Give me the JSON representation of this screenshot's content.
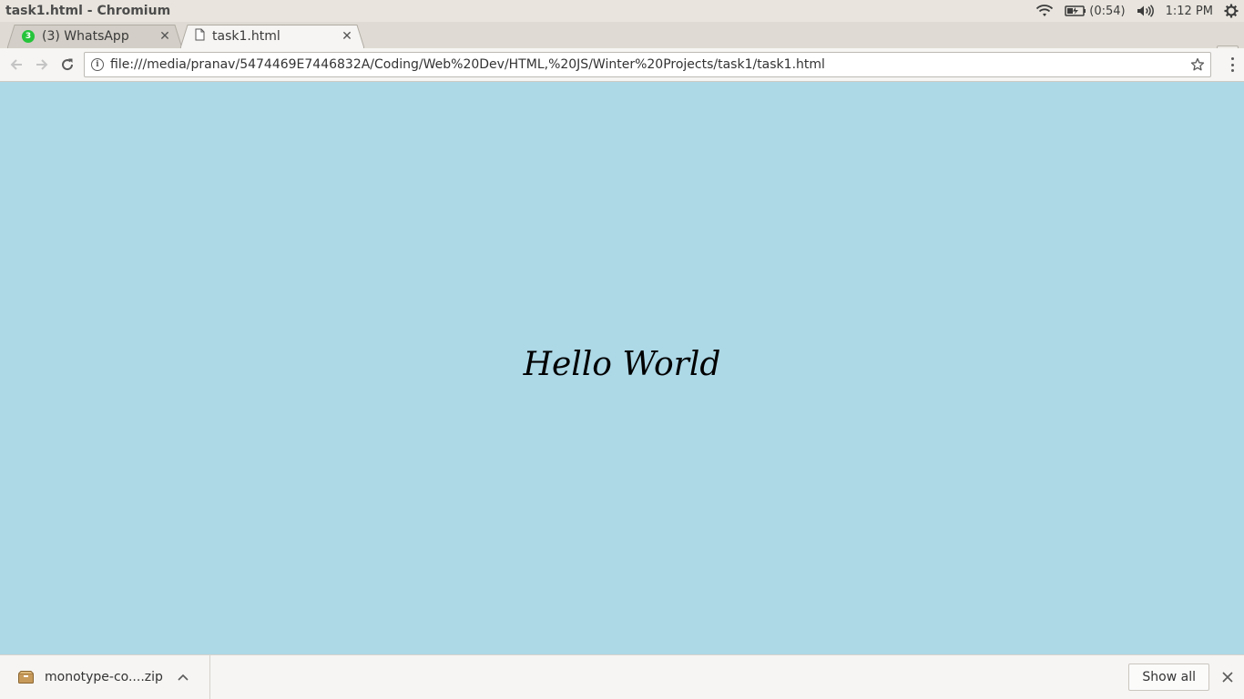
{
  "window": {
    "title": "task1.html - Chromium"
  },
  "system_tray": {
    "battery_text": "(0:54)",
    "clock": "1:12 PM",
    "icons": [
      "wifi-icon",
      "battery-icon",
      "volume-icon",
      "settings-gear-icon"
    ]
  },
  "tabs": [
    {
      "label": "(3) WhatsApp",
      "badge": "3",
      "icon": "whatsapp-icon",
      "active": false
    },
    {
      "label": "task1.html",
      "icon": "file-icon",
      "active": true
    }
  ],
  "toolbar": {
    "url": "file:///media/pranav/5474469E7446832A/Coding/Web%20Dev/HTML,%20JS/Winter%20Projects/task1/task1.html"
  },
  "page": {
    "heading": "Hello World",
    "background": "#add8e6"
  },
  "download_shelf": {
    "file_name": "monotype-co....zip",
    "show_all_label": "Show all"
  },
  "colors": {
    "page_background": "#add8e6",
    "whatsapp_badge": "#25c43b"
  }
}
